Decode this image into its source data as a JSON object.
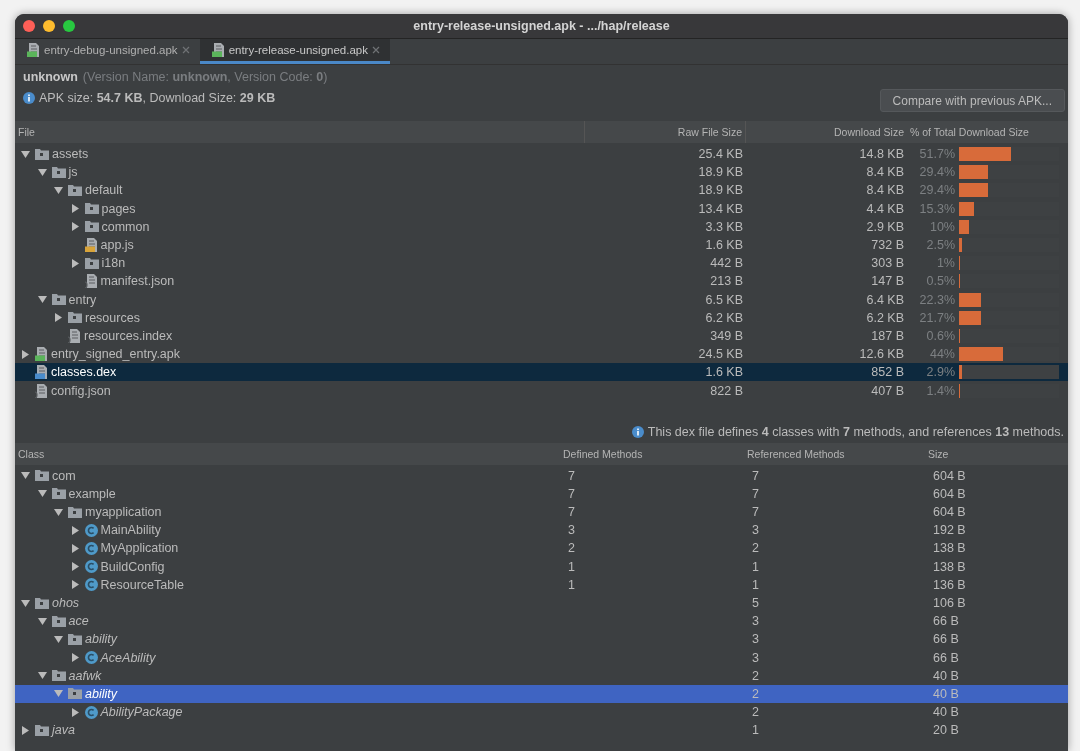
{
  "window": {
    "title": "entry-release-unsigned.apk - .../hap/release"
  },
  "tabs": [
    {
      "label": "entry-debug-unsigned.apk",
      "selected": false
    },
    {
      "label": "entry-release-unsigned.apk",
      "selected": true
    }
  ],
  "summary": {
    "app_name": "unknown",
    "version_text": "(Version Name: **unknown**, Version Code: **0**)",
    "size_text": "APK size: **54.7 KB**, Download Size: **29 KB**"
  },
  "compare_button": "Compare with previous APK...",
  "file_table": {
    "columns": [
      "File",
      "Raw File Size",
      "Download Size",
      "% of Total Download Size"
    ],
    "rows": [
      {
        "name": "assets",
        "kind": "folder",
        "expanded": true,
        "selected": false,
        "raw": "25.4 KB",
        "download": "14.8 KB",
        "percent": "51.7%",
        "level": 0.517,
        "children": [
          {
            "name": "js",
            "kind": "folder",
            "expanded": true,
            "selected": false,
            "raw": "18.9 KB",
            "download": "8.4 KB",
            "percent": "29.4%",
            "level": 0.294,
            "children": [
              {
                "name": "default",
                "kind": "folder",
                "expanded": true,
                "selected": false,
                "raw": "18.9 KB",
                "download": "8.4 KB",
                "percent": "29.4%",
                "level": 0.294,
                "children": [
                  {
                    "name": "pages",
                    "kind": "folder",
                    "expanded": false,
                    "selected": false,
                    "raw": "13.4 KB",
                    "download": "4.4 KB",
                    "percent": "15.3%",
                    "level": 0.153
                  },
                  {
                    "name": "common",
                    "kind": "folder",
                    "expanded": false,
                    "selected": false,
                    "raw": "3.3 KB",
                    "download": "2.9 KB",
                    "percent": "10%",
                    "level": 0.1
                  },
                  {
                    "name": "app.js",
                    "kind": "js",
                    "selected": false,
                    "raw": "1.6 KB",
                    "download": "732 B",
                    "percent": "2.5%",
                    "level": 0.025
                  },
                  {
                    "name": "i18n",
                    "kind": "folder",
                    "expanded": false,
                    "selected": false,
                    "raw": "442 B",
                    "download": "303 B",
                    "percent": "1%",
                    "level": 0.01
                  },
                  {
                    "name": "manifest.json",
                    "kind": "json",
                    "selected": false,
                    "raw": "213 B",
                    "download": "147 B",
                    "percent": "0.5%",
                    "level": 0.005
                  }
                ]
              }
            ]
          },
          {
            "name": "entry",
            "kind": "folder",
            "expanded": true,
            "selected": false,
            "raw": "6.5 KB",
            "download": "6.4 KB",
            "percent": "22.3%",
            "level": 0.223,
            "children": [
              {
                "name": "resources",
                "kind": "folder",
                "expanded": false,
                "selected": false,
                "raw": "6.2 KB",
                "download": "6.2 KB",
                "percent": "21.7%",
                "level": 0.217
              },
              {
                "name": "resources.index",
                "kind": "index",
                "selected": false,
                "raw": "349 B",
                "download": "187 B",
                "percent": "0.6%",
                "level": 0.006
              }
            ]
          }
        ]
      },
      {
        "name": "entry_signed_entry.apk",
        "kind": "apk",
        "expanded": false,
        "selected": false,
        "raw": "24.5 KB",
        "download": "12.6 KB",
        "percent": "44%",
        "level": 0.44
      },
      {
        "name": "classes.dex",
        "kind": "dex",
        "selected": true,
        "raw": "1.6 KB",
        "download": "852 B",
        "percent": "2.9%",
        "level": 0.029
      },
      {
        "name": "config.json",
        "kind": "json",
        "selected": false,
        "raw": "822 B",
        "download": "407 B",
        "percent": "1.4%",
        "level": 0.014
      }
    ]
  },
  "dex_info": "This dex file defines **4** classes with **7** methods, and references **13** methods.",
  "class_table": {
    "columns": [
      "Class",
      "Defined Methods",
      "Referenced Methods",
      "Size"
    ],
    "rows": [
      {
        "name": "com",
        "kind": "package",
        "expanded": true,
        "selected": false,
        "external": false,
        "defined": "7",
        "referenced": "7",
        "size": "604 B",
        "children": [
          {
            "name": "example",
            "kind": "package",
            "expanded": true,
            "selected": false,
            "external": false,
            "defined": "7",
            "referenced": "7",
            "size": "604 B",
            "children": [
              {
                "name": "myapplication",
                "kind": "package",
                "expanded": true,
                "selected": false,
                "external": false,
                "defined": "7",
                "referenced": "7",
                "size": "604 B",
                "children": [
                  {
                    "name": "MainAbility",
                    "kind": "class",
                    "expanded": false,
                    "selected": false,
                    "external": false,
                    "defined": "3",
                    "referenced": "3",
                    "size": "192 B"
                  },
                  {
                    "name": "MyApplication",
                    "kind": "class",
                    "expanded": false,
                    "selected": false,
                    "external": false,
                    "defined": "2",
                    "referenced": "2",
                    "size": "138 B"
                  },
                  {
                    "name": "BuildConfig",
                    "kind": "class",
                    "expanded": false,
                    "selected": false,
                    "external": false,
                    "defined": "1",
                    "referenced": "1",
                    "size": "138 B"
                  },
                  {
                    "name": "ResourceTable",
                    "kind": "class",
                    "expanded": false,
                    "selected": false,
                    "external": false,
                    "defined": "1",
                    "referenced": "1",
                    "size": "136 B"
                  }
                ]
              }
            ]
          }
        ]
      },
      {
        "name": "ohos",
        "kind": "package",
        "expanded": true,
        "selected": false,
        "external": true,
        "referenced": "5",
        "size": "106 B",
        "children": [
          {
            "name": "ace",
            "kind": "package",
            "expanded": true,
            "selected": false,
            "external": true,
            "referenced": "3",
            "size": "66 B",
            "children": [
              {
                "name": "ability",
                "kind": "package",
                "expanded": true,
                "selected": false,
                "external": true,
                "referenced": "3",
                "size": "66 B",
                "children": [
                  {
                    "name": "AceAbility",
                    "kind": "class",
                    "expanded": false,
                    "selected": false,
                    "external": true,
                    "referenced": "3",
                    "size": "66 B"
                  }
                ]
              }
            ]
          },
          {
            "name": "aafwk",
            "kind": "package",
            "expanded": true,
            "selected": false,
            "external": true,
            "referenced": "2",
            "size": "40 B",
            "children": [
              {
                "name": "ability",
                "kind": "package",
                "expanded": true,
                "selected": true,
                "external": true,
                "referenced": "2",
                "size": "40 B",
                "children": [
                  {
                    "name": "AbilityPackage",
                    "kind": "class",
                    "expanded": false,
                    "selected": false,
                    "external": true,
                    "referenced": "2",
                    "size": "40 B"
                  }
                ]
              }
            ]
          }
        ]
      },
      {
        "name": "java",
        "kind": "package",
        "expanded": false,
        "selected": false,
        "external": true,
        "referenced": "1",
        "size": "20 B"
      }
    ]
  }
}
